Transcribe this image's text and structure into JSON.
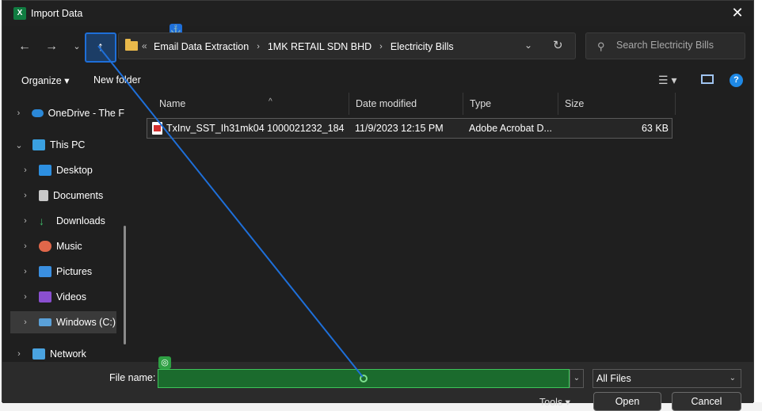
{
  "window": {
    "title": "Import Data",
    "app_icon_letter": "X"
  },
  "nav": {
    "back_icon": "arrow-left-icon",
    "forward_icon": "arrow-right-icon",
    "recent_icon": "chevron-down-icon",
    "up_icon": "arrow-up-icon"
  },
  "address": {
    "lead": "«",
    "crumbs": [
      "Email Data Extraction",
      "1MK RETAIL SDN BHD",
      "Electricity Bills"
    ]
  },
  "search": {
    "placeholder": "Search Electricity Bills"
  },
  "commandbar": {
    "organize": "Organize ▾",
    "new_folder": "New folder",
    "help": "?"
  },
  "sidebar": {
    "items": [
      {
        "label": "OneDrive - The F",
        "chevron": "›"
      },
      {
        "label": "This PC",
        "chevron": "⌄"
      },
      {
        "label": "Desktop",
        "chevron": "›"
      },
      {
        "label": "Documents",
        "chevron": "›"
      },
      {
        "label": "Downloads",
        "chevron": "›"
      },
      {
        "label": "Music",
        "chevron": "›"
      },
      {
        "label": "Pictures",
        "chevron": "›"
      },
      {
        "label": "Videos",
        "chevron": "›"
      },
      {
        "label": "Windows (C:)",
        "chevron": "›"
      },
      {
        "label": "Network",
        "chevron": "›"
      }
    ]
  },
  "columns": {
    "name": "Name",
    "date": "Date modified",
    "type": "Type",
    "size": "Size"
  },
  "files": [
    {
      "name": "TxInv_SST_Ih31mk04 1000021232_184",
      "date": "11/9/2023 12:15 PM",
      "type": "Adobe Acrobat D...",
      "size": "63 KB"
    }
  ],
  "bottom": {
    "file_name_label": "File name:",
    "file_name_value": "",
    "file_type": "All Files",
    "tools": "Tools ▾",
    "open": "Open",
    "cancel": "Cancel"
  },
  "colors": {
    "accent_blue": "#1e6fd9",
    "accent_green": "#3ec45a",
    "dialog_bg": "#1f1f1f"
  }
}
